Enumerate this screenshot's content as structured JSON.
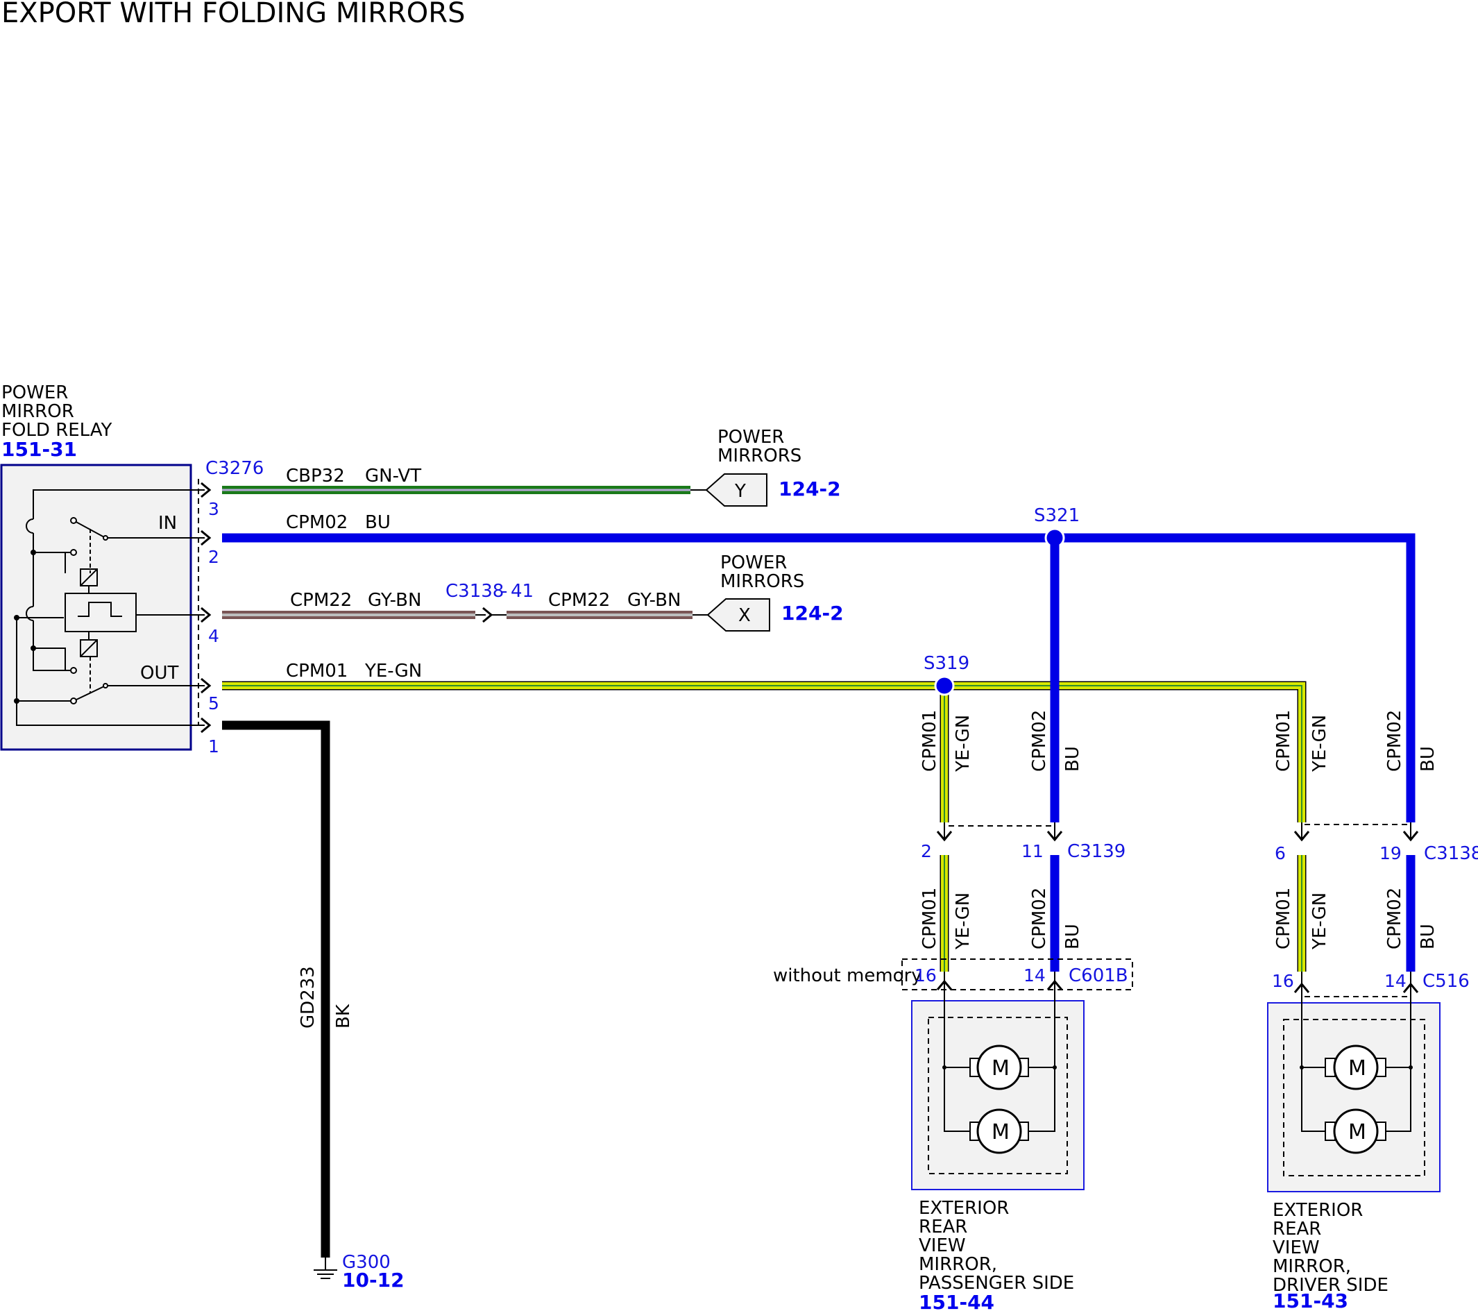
{
  "title": "EXPORT WITH FOLDING MIRRORS",
  "colors": {
    "blue_wire": "#0000e6",
    "yellow_green_wire": "#d8e800",
    "green_violet_wire": "#1a7a1a",
    "gray_brown_wire": "#8a6d6d",
    "black_wire": "#000000",
    "component_border": "#00008b",
    "reference_text": "#0000ee",
    "pin_text": "#1414e0"
  },
  "relay": {
    "name_lines": [
      "POWER",
      "MIRROR",
      "FOLD RELAY"
    ],
    "ref": "151-31",
    "connector": "C3276",
    "in_label": "IN",
    "out_label": "OUT",
    "pins": [
      "3",
      "2",
      "4",
      "5",
      "1"
    ]
  },
  "wires": {
    "cbp32": {
      "circuit": "CBP32",
      "color": "GN-VT"
    },
    "cpm02": {
      "circuit": "CPM02",
      "color": "BU"
    },
    "cpm22": {
      "circuit": "CPM22",
      "color": "GY-BN"
    },
    "cpm01": {
      "circuit": "CPM01",
      "color": "YE-GN"
    },
    "gd233": {
      "circuit": "GD233",
      "color": "BK"
    }
  },
  "inline_connector": {
    "name": "C3138",
    "pin": "41"
  },
  "power_mirrors_y": {
    "name_lines": [
      "POWER",
      "MIRRORS"
    ],
    "letter": "Y",
    "ref": "124-2"
  },
  "power_mirrors_x": {
    "name_lines": [
      "POWER",
      "MIRRORS"
    ],
    "letter": "X",
    "ref": "124-2"
  },
  "splices": {
    "s321": "S321",
    "s319": "S319"
  },
  "passenger_connectors": {
    "upper": {
      "name": "C3139",
      "pin_left": "2",
      "pin_right": "11"
    },
    "lower": {
      "name": "C601B",
      "pin_left": "16",
      "pin_right": "14",
      "note": "without memory"
    }
  },
  "driver_connectors": {
    "upper": {
      "name": "C3138",
      "pin_left": "6",
      "pin_right": "19"
    },
    "lower": {
      "name": "C516",
      "pin_left": "16",
      "pin_right": "14"
    }
  },
  "passenger_mirror": {
    "name_lines": [
      "EXTERIOR",
      "REAR",
      "VIEW",
      "MIRROR,",
      "PASSENGER SIDE"
    ],
    "ref": "151-44",
    "motor_label": "M"
  },
  "driver_mirror": {
    "name_lines": [
      "EXTERIOR",
      "REAR",
      "VIEW",
      "MIRROR,",
      "DRIVER SIDE"
    ],
    "ref": "151-43",
    "motor_label": "M"
  },
  "ground": {
    "name": "G300",
    "ref": "10-12"
  }
}
